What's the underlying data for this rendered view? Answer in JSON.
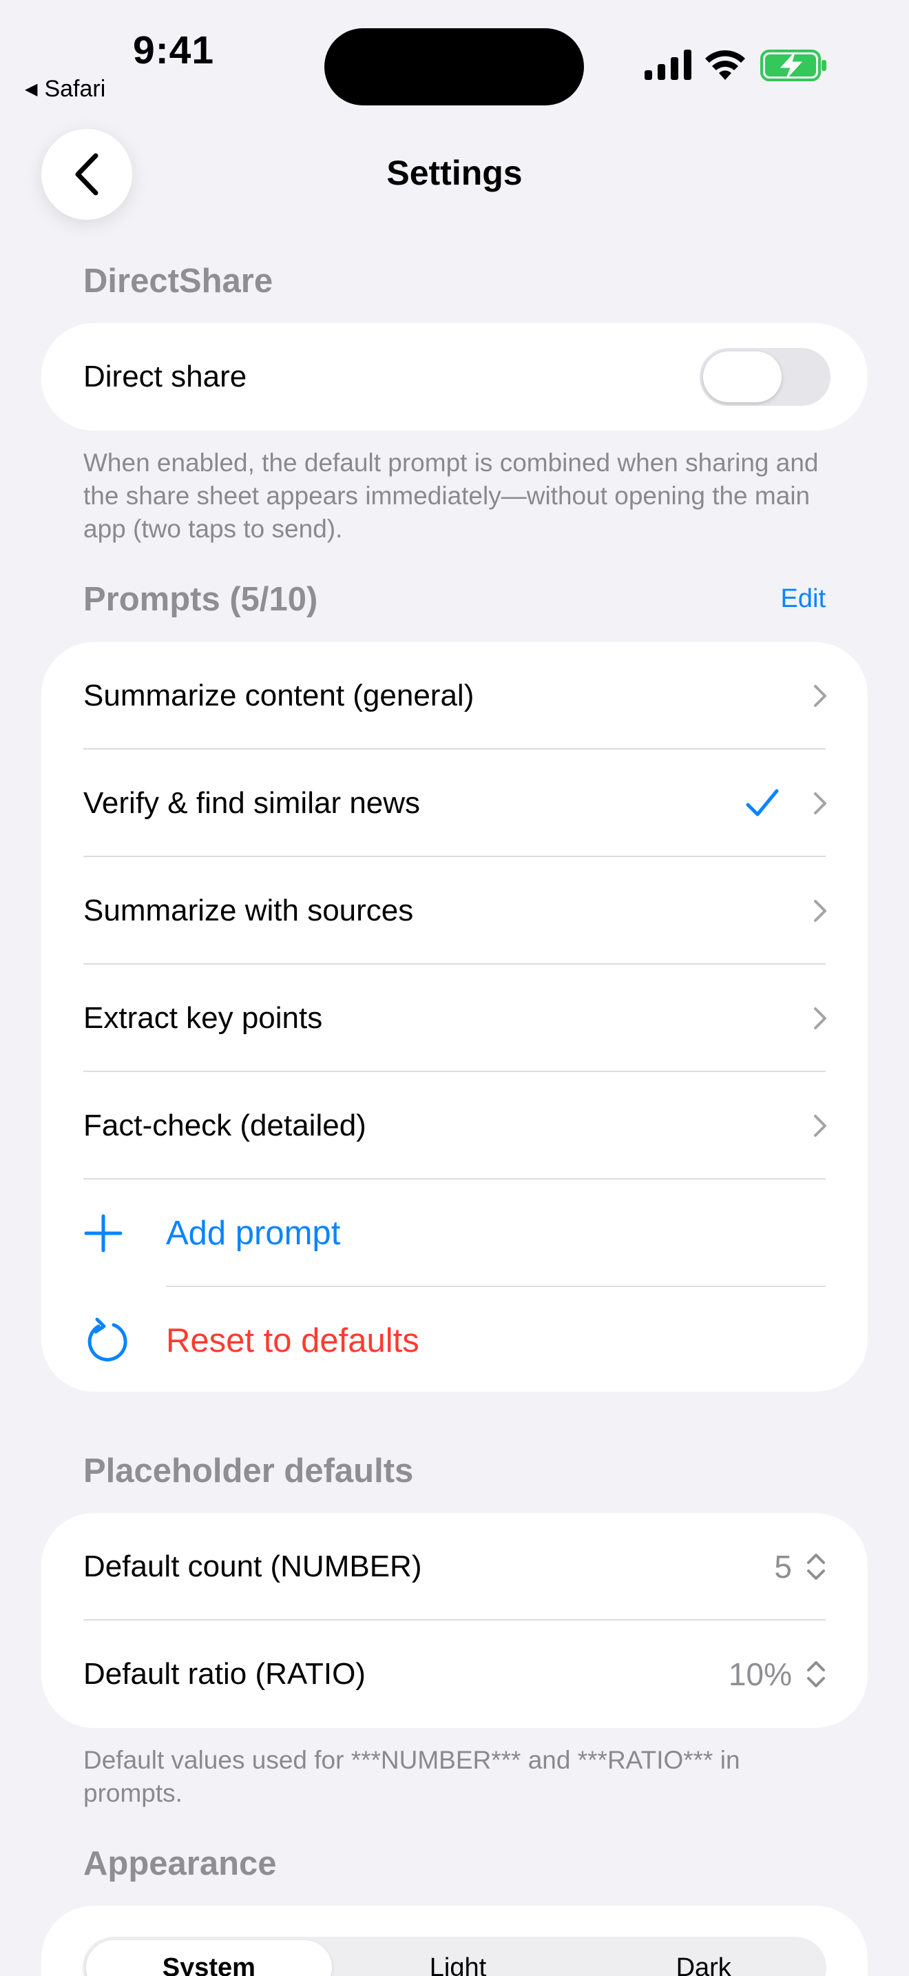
{
  "status_bar": {
    "time": "9:41",
    "back_app": "Safari"
  },
  "nav": {
    "title": "Settings"
  },
  "direct_share": {
    "header": "DirectShare",
    "toggle_label": "Direct share",
    "toggle_on": false,
    "footer": "When enabled, the default prompt is combined when sharing and the share sheet appears immediately—without opening the main app (two taps to send)."
  },
  "prompts": {
    "header": "Prompts (5/10)",
    "edit_label": "Edit",
    "items": [
      {
        "label": "Summarize content (general)",
        "selected": false
      },
      {
        "label": "Verify & find similar news",
        "selected": true
      },
      {
        "label": "Summarize with sources",
        "selected": false
      },
      {
        "label": "Extract key points",
        "selected": false
      },
      {
        "label": "Fact-check (detailed)",
        "selected": false
      }
    ],
    "add_label": "Add prompt",
    "reset_label": "Reset to defaults"
  },
  "placeholder_defaults": {
    "header": "Placeholder defaults",
    "count_label": "Default count (NUMBER)",
    "count_value": "5",
    "ratio_label": "Default ratio (RATIO)",
    "ratio_value": "10%",
    "footer": "Default values used for ***NUMBER*** and ***RATIO*** in prompts."
  },
  "appearance": {
    "header": "Appearance",
    "options": [
      "System",
      "Light",
      "Dark"
    ],
    "selected": "System"
  },
  "colors": {
    "accent": "#0A84FF",
    "destructive": "#FF3B30",
    "battery": "#34C759"
  }
}
